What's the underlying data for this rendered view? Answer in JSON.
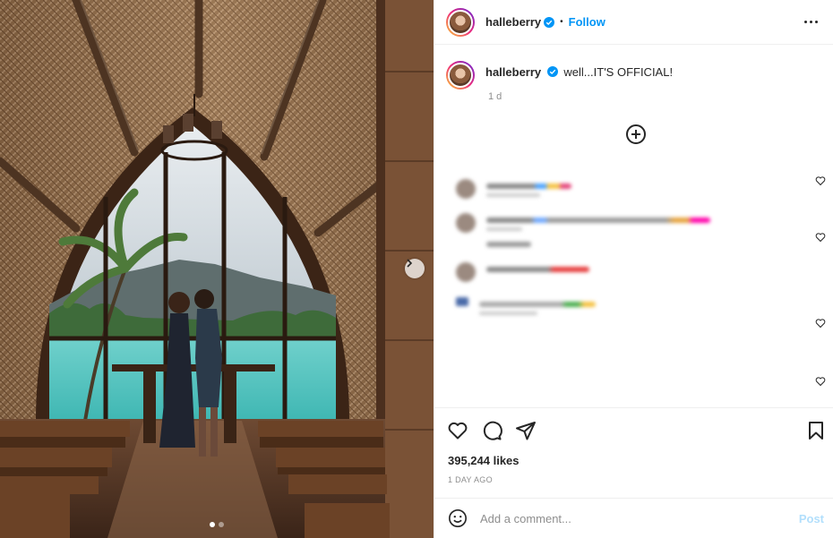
{
  "post": {
    "username": "halleberry",
    "verified": true,
    "follow_label": "Follow",
    "separator": "•",
    "caption": "well...IT'S OFFICIAL!",
    "caption_age": "1 d",
    "likes": "395,244 likes",
    "date": "1 DAY AGO",
    "carousel": {
      "count": 2,
      "active": 1
    }
  },
  "comment_box": {
    "placeholder": "Add a comment...",
    "post_label": "Post"
  },
  "icons": {
    "more": "more-options-icon",
    "load_more": "plus-circle-icon",
    "like": "heart-icon",
    "comment": "comment-icon",
    "share": "share-icon",
    "save": "bookmark-icon",
    "emoji": "emoji-icon",
    "next": "chevron-right-icon"
  },
  "colors": {
    "accent": "#0095f6",
    "post_disabled": "#b2dffc",
    "muted": "#8e8e8e"
  }
}
